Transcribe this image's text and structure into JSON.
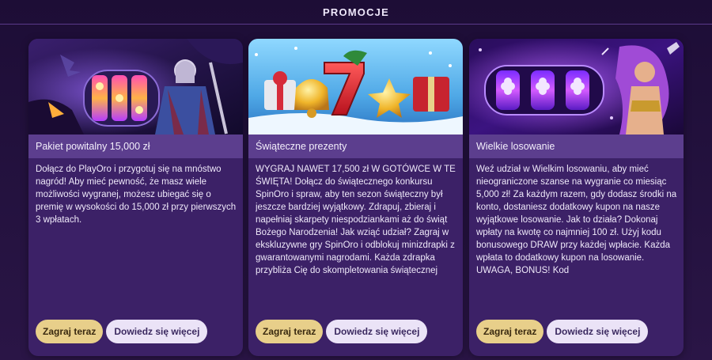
{
  "header": {
    "title": "PROMOCJE"
  },
  "colors": {
    "page_bg": "#1f0f3a",
    "card_bg": "#3c2167",
    "title_bar_bg": "#5c3e8e",
    "play_button": "#e8cf8a",
    "more_button": "#ebe3f7"
  },
  "cards": [
    {
      "banner_icon": "warrior-slot-reels-banner",
      "title": "Pakiet powitalny 15,000 zł",
      "description": " Dołącz do PlayOro i przygotuj się na mnóstwo nagród! Aby mieć pewność, że masz wiele możliwości wygranej, możesz ubiegać się o premię w wysokości do 15,000 zł przy pierwszych 3 wpłatach.",
      "play_label": "Zagraj teraz",
      "more_label": "Dowiedz się więcej"
    },
    {
      "banner_icon": "christmas-seven-bells-banner",
      "title": "Świąteczne prezenty",
      "description": "WYGRAJ NAWET 17,500 zł W GOTÓWCE W TE ŚWIĘTA! Dołącz do świątecznego konkursu SpinOro i spraw, aby ten sezon świąteczny był jeszcze bardziej wyjątkowy. Zdrapuj, zbieraj i napełniaj skarpety niespodziankami aż do świąt Bożego Narodzenia! Jak wziąć udział? Zagraj w ekskluzywne gry SpinOro i odblokuj minizdrapki z gwarantowanymi nagrodami. Każda zdrapka przybliża Cię do skompletowania świątecznej",
      "play_label": "Zagraj teraz",
      "more_label": "Dowiedz się więcej"
    },
    {
      "banner_icon": "sorceress-slot-reels-banner",
      "title": "Wielkie losowanie",
      "description": "Weź udział w Wielkim losowaniu, aby mieć nieograniczone szanse na wygranie co miesiąc 5,000 zł! Za każdym razem, gdy dodasz środki na konto, dostaniesz dodatkowy kupon na nasze wyjątkowe losowanie.  Jak to działa? Dokonaj wpłaty na kwotę co najmniej 100 zł. Użyj kodu bonusowego DRAW przy każdej wpłacie. Każda wpłata to dodatkowy kupon na losowanie. UWAGA, BONUS! Kod",
      "play_label": "Zagraj teraz",
      "more_label": "Dowiedz się więcej"
    }
  ]
}
